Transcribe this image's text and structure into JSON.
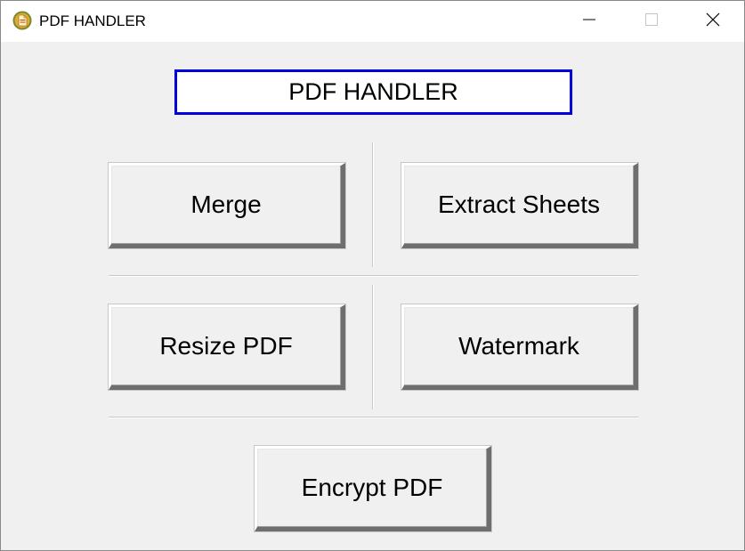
{
  "window": {
    "title": "PDF HANDLER",
    "app_icon": "pdf-app-icon",
    "controls": {
      "minimize_icon": "minimize-icon",
      "maximize_icon": "maximize-icon",
      "close_icon": "close-icon"
    }
  },
  "main": {
    "header_label": "PDF HANDLER",
    "header_border_color": "#0000dd",
    "buttons": {
      "merge": "Merge",
      "extract_sheets": "Extract Sheets",
      "resize_pdf": "Resize PDF",
      "watermark": "Watermark",
      "encrypt_pdf": "Encrypt PDF"
    }
  }
}
